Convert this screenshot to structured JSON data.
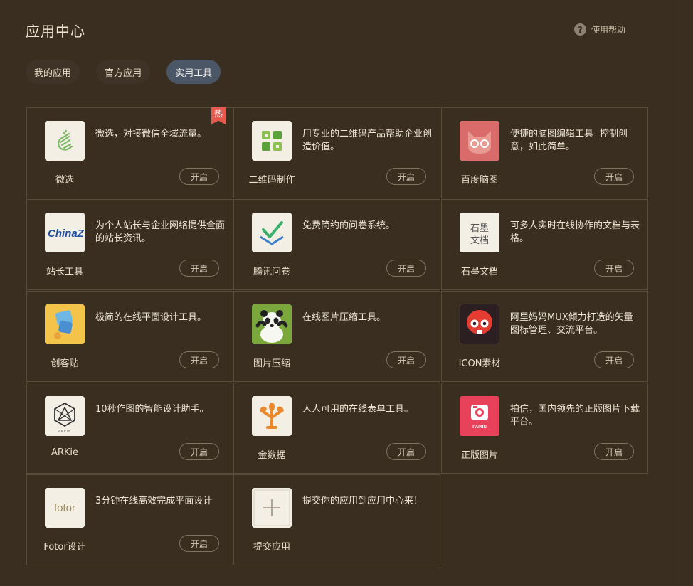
{
  "header": {
    "title": "应用中心",
    "help_label": "使用帮助",
    "help_icon": "?"
  },
  "tabs": [
    {
      "label": "我的应用",
      "active": false
    },
    {
      "label": "官方应用",
      "active": false
    },
    {
      "label": "实用工具",
      "active": true
    }
  ],
  "apps": [
    {
      "name": "微选",
      "desc": "微选，对接微信全域流量。",
      "button": "开启",
      "icon": "weixuan-icon",
      "badge": "热"
    },
    {
      "name": "二维码制作",
      "desc": "用专业的二维码产品帮助企业创造价值。",
      "button": "开启",
      "icon": "qrcode-icon"
    },
    {
      "name": "百度脑图",
      "desc": "便捷的脑图编辑工具- 控制创意，如此简单。",
      "button": "开启",
      "icon": "baidu-naotu-icon"
    },
    {
      "name": "站长工具",
      "desc": "为个人站长与企业网络提供全面的站长资讯。",
      "button": "开启",
      "icon": "chinaz-icon",
      "icon_text": "ChinaZ"
    },
    {
      "name": "腾讯问卷",
      "desc": "免费简约的问卷系统。",
      "button": "开启",
      "icon": "tencent-wenjuan-icon"
    },
    {
      "name": "石墨文档",
      "desc": "可多人实时在线协作的文档与表格。",
      "button": "开启",
      "icon": "shimo-icon",
      "icon_text": [
        "石墨",
        "文档"
      ]
    },
    {
      "name": "创客贴",
      "desc": "极简的在线平面设计工具。",
      "button": "开启",
      "icon": "chuangkit-icon"
    },
    {
      "name": "图片压缩",
      "desc": "在线图片压缩工具。",
      "button": "开启",
      "icon": "panda-icon"
    },
    {
      "name": "ICON素材",
      "desc": "阿里妈妈MUX倾力打造的矢量图标管理、交流平台。",
      "button": "开启",
      "icon": "iconfont-icon"
    },
    {
      "name": "ARKie",
      "desc": "10秒作图的智能设计助手。",
      "button": "开启",
      "icon": "arkie-icon",
      "icon_text": "ARKIE"
    },
    {
      "name": "金数据",
      "desc": "人人可用的在线表单工具。",
      "button": "开启",
      "icon": "jinshuju-icon"
    },
    {
      "name": "正版图片",
      "desc": "拍信，国内领先的正版图片下载平台。",
      "button": "开启",
      "icon": "paixin-icon",
      "icon_text": "PAIXIN"
    },
    {
      "name": "Fotor设计",
      "desc": "3分钟在线高效完成平面设计",
      "button": "开启",
      "icon": "fotor-icon",
      "icon_text": "fotor"
    },
    {
      "name": "提交应用",
      "desc": "提交你的应用到应用中心来！",
      "icon": "plus-icon"
    }
  ],
  "colors": {
    "background": "#3a2e21",
    "active_tab": "#4b5766",
    "hot_badge": "#e8584c"
  }
}
